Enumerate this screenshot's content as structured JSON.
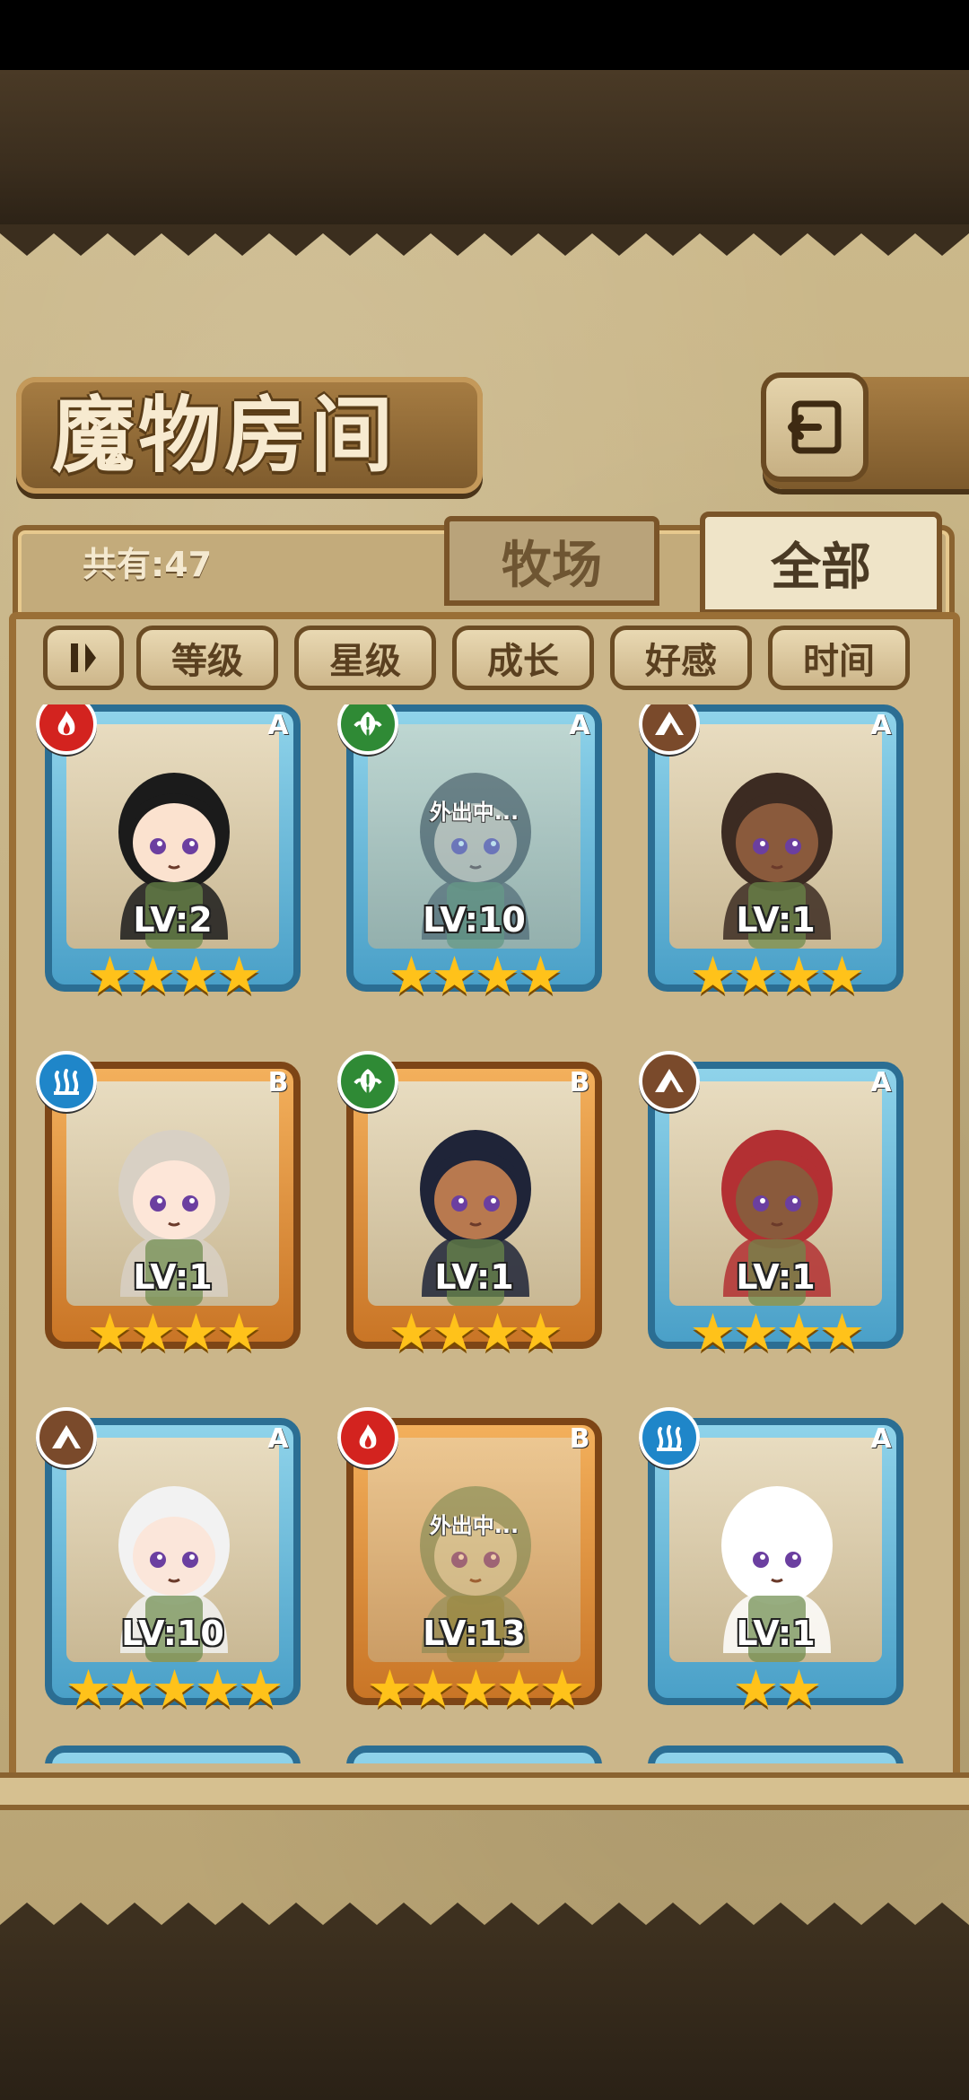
{
  "screen": {
    "title": "魔物房间",
    "count_text": "共有:47"
  },
  "tabs": [
    {
      "label": "牧场",
      "active": false
    },
    {
      "label": "全部",
      "active": true
    }
  ],
  "filters": {
    "toggle_icon": "sort-toggle-icon",
    "items": [
      "等级",
      "星级",
      "成长",
      "好感",
      "时间"
    ]
  },
  "colors": {
    "fire": "#d3231f",
    "water": "#1f86c9",
    "earth": "#7a4a2b",
    "grass": "#2f8a35",
    "frame_blue": "#4aa0c8",
    "frame_orange": "#c97526",
    "star": "#ffc21a"
  },
  "monsters": [
    {
      "element": "fire",
      "rank": "A",
      "level": "LV:2",
      "stars": 4,
      "frame": "blue",
      "away": false,
      "away_text": ""
    },
    {
      "element": "grass",
      "rank": "A",
      "level": "LV:10",
      "stars": 4,
      "frame": "blue",
      "away": true,
      "away_text": "外出中..."
    },
    {
      "element": "earth",
      "rank": "A",
      "level": "LV:1",
      "stars": 4,
      "frame": "blue",
      "away": false,
      "away_text": ""
    },
    {
      "element": "water",
      "rank": "B",
      "level": "LV:1",
      "stars": 4,
      "frame": "orange",
      "away": false,
      "away_text": ""
    },
    {
      "element": "grass",
      "rank": "B",
      "level": "LV:1",
      "stars": 4,
      "frame": "orange",
      "away": false,
      "away_text": ""
    },
    {
      "element": "earth",
      "rank": "A",
      "level": "LV:1",
      "stars": 4,
      "frame": "blue",
      "away": false,
      "away_text": ""
    },
    {
      "element": "earth",
      "rank": "A",
      "level": "LV:10",
      "stars": 5,
      "frame": "blue",
      "away": false,
      "away_text": ""
    },
    {
      "element": "fire",
      "rank": "B",
      "level": "LV:13",
      "stars": 5,
      "frame": "orange",
      "away": true,
      "away_text": "外出中..."
    },
    {
      "element": "water",
      "rank": "A",
      "level": "LV:1",
      "stars": 2,
      "frame": "blue",
      "away": false,
      "away_text": ""
    }
  ]
}
